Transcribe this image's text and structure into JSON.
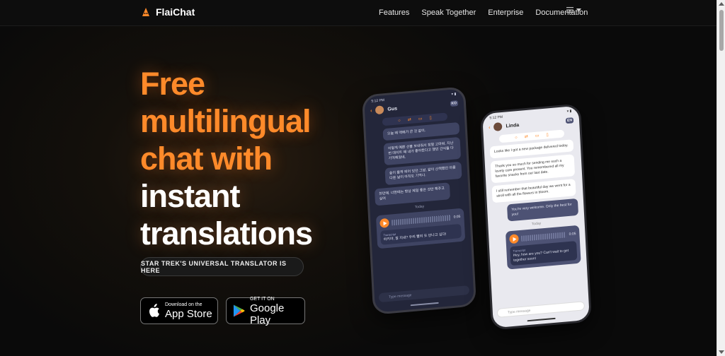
{
  "brand": {
    "name": "FlaiChat",
    "accent": "#ff8a2a"
  },
  "nav": {
    "items": [
      "Features",
      "Speak Together",
      "Enterprise",
      "Documentation"
    ],
    "menu_icon": "hamburger-icon"
  },
  "hero": {
    "headline_orange": [
      "Free",
      "multilingual",
      "chat with"
    ],
    "headline_white": [
      "instant",
      "translations"
    ],
    "tagline": "STAR TREK'S UNIVERSAL TRANSLATOR IS HERE"
  },
  "stores": {
    "app_store": {
      "small": "Download on the",
      "big": "App Store",
      "icon": "apple-icon"
    },
    "google_play": {
      "small": "GET IT ON",
      "big": "Google Play",
      "icon": "google-play-icon"
    }
  },
  "phone_dark": {
    "time": "5:12 PM",
    "contact": "Gus",
    "badge": "KO",
    "messages": [
      "오늘 왜 맥배가 큰 것 같이.",
      "이렇게 예쁜 선물 보내줘서 정말 고마워. 지난번 데이트 때 내가 좋아한다고 했던 간식들 다 기억해줬네.",
      "숲이 활짝 피어 있던 그날, 같이 산책했던 아름다운 날이 아직도 기억나.",
      "천만에. 너한테는 항상 제일 좋은 것만 해주고 싶어"
    ],
    "today": "Today",
    "voice_duration": "0:05",
    "transcript_label": "Transcript",
    "transcript": "하키야, 잘 지내? 우리 빨리 또 만나고 싶다!",
    "input_placeholder": "Type message"
  },
  "phone_light": {
    "time": "5:12 PM",
    "contact": "Linda",
    "badge": "EN",
    "messages": [
      "Looks like I got a new package delivered today.",
      "Thank you so much for sending me such a lovely care present. You remembered all my favorite snacks from our last date.",
      "I still remember that beautiful day we went for a stroll with all the flowers in bloom.",
      "You're very welcome. Only the best for you!"
    ],
    "today": "Today",
    "voice_duration": "0:05",
    "transcript_label": "Transcript",
    "transcript": "Hey, how are you? Can't wait to get together soon!",
    "input_placeholder": "Type message"
  }
}
